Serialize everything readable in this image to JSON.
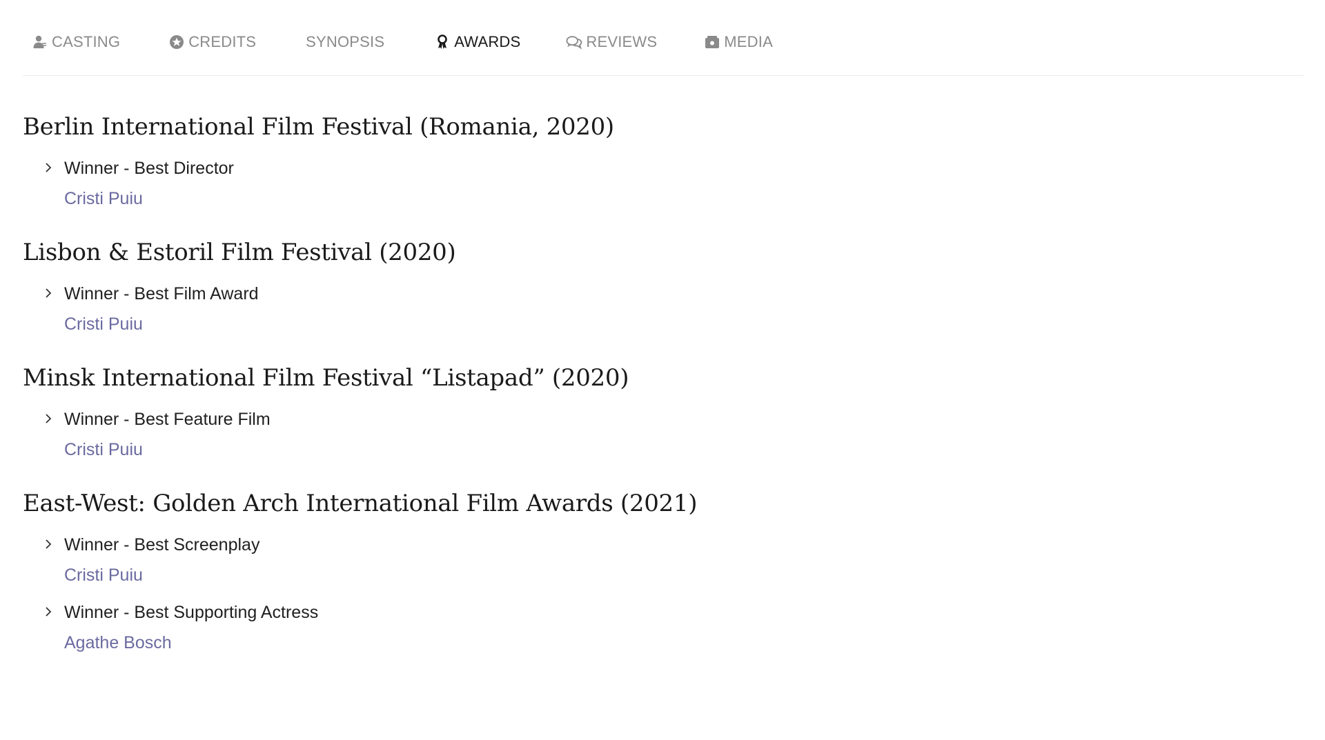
{
  "tabs": [
    {
      "label": "CASTING",
      "icon": "person-icon",
      "active": false
    },
    {
      "label": "CREDITS",
      "icon": "star-icon",
      "active": false
    },
    {
      "label": "SYNOPSIS",
      "icon": "",
      "active": false
    },
    {
      "label": "AWARDS",
      "icon": "ribbon-icon",
      "active": true
    },
    {
      "label": "REVIEWS",
      "icon": "chat-icon",
      "active": false
    },
    {
      "label": "MEDIA",
      "icon": "camera-icon",
      "active": false
    }
  ],
  "colors": {
    "tab_inactive": "#8a8a8a",
    "tab_active": "#1a1a1a",
    "person_link": "#6a6aa0",
    "divider": "#e9e9e9"
  },
  "festivals": [
    {
      "title": "Berlin International Film Festival (Romania, 2020)",
      "awards": [
        {
          "title": "Winner - Best Director",
          "person": "Cristi Puiu"
        }
      ]
    },
    {
      "title": "Lisbon & Estoril Film Festival (2020)",
      "awards": [
        {
          "title": "Winner - Best Film Award",
          "person": "Cristi Puiu"
        }
      ]
    },
    {
      "title": "Minsk International Film Festival “Listapad” (2020)",
      "awards": [
        {
          "title": "Winner - Best Feature Film",
          "person": "Cristi Puiu"
        }
      ]
    },
    {
      "title": "East-West: Golden Arch International Film Awards (2021)",
      "awards": [
        {
          "title": "Winner - Best Screenplay",
          "person": "Cristi Puiu"
        },
        {
          "title": "Winner - Best Supporting Actress",
          "person": "Agathe Bosch"
        }
      ]
    }
  ]
}
